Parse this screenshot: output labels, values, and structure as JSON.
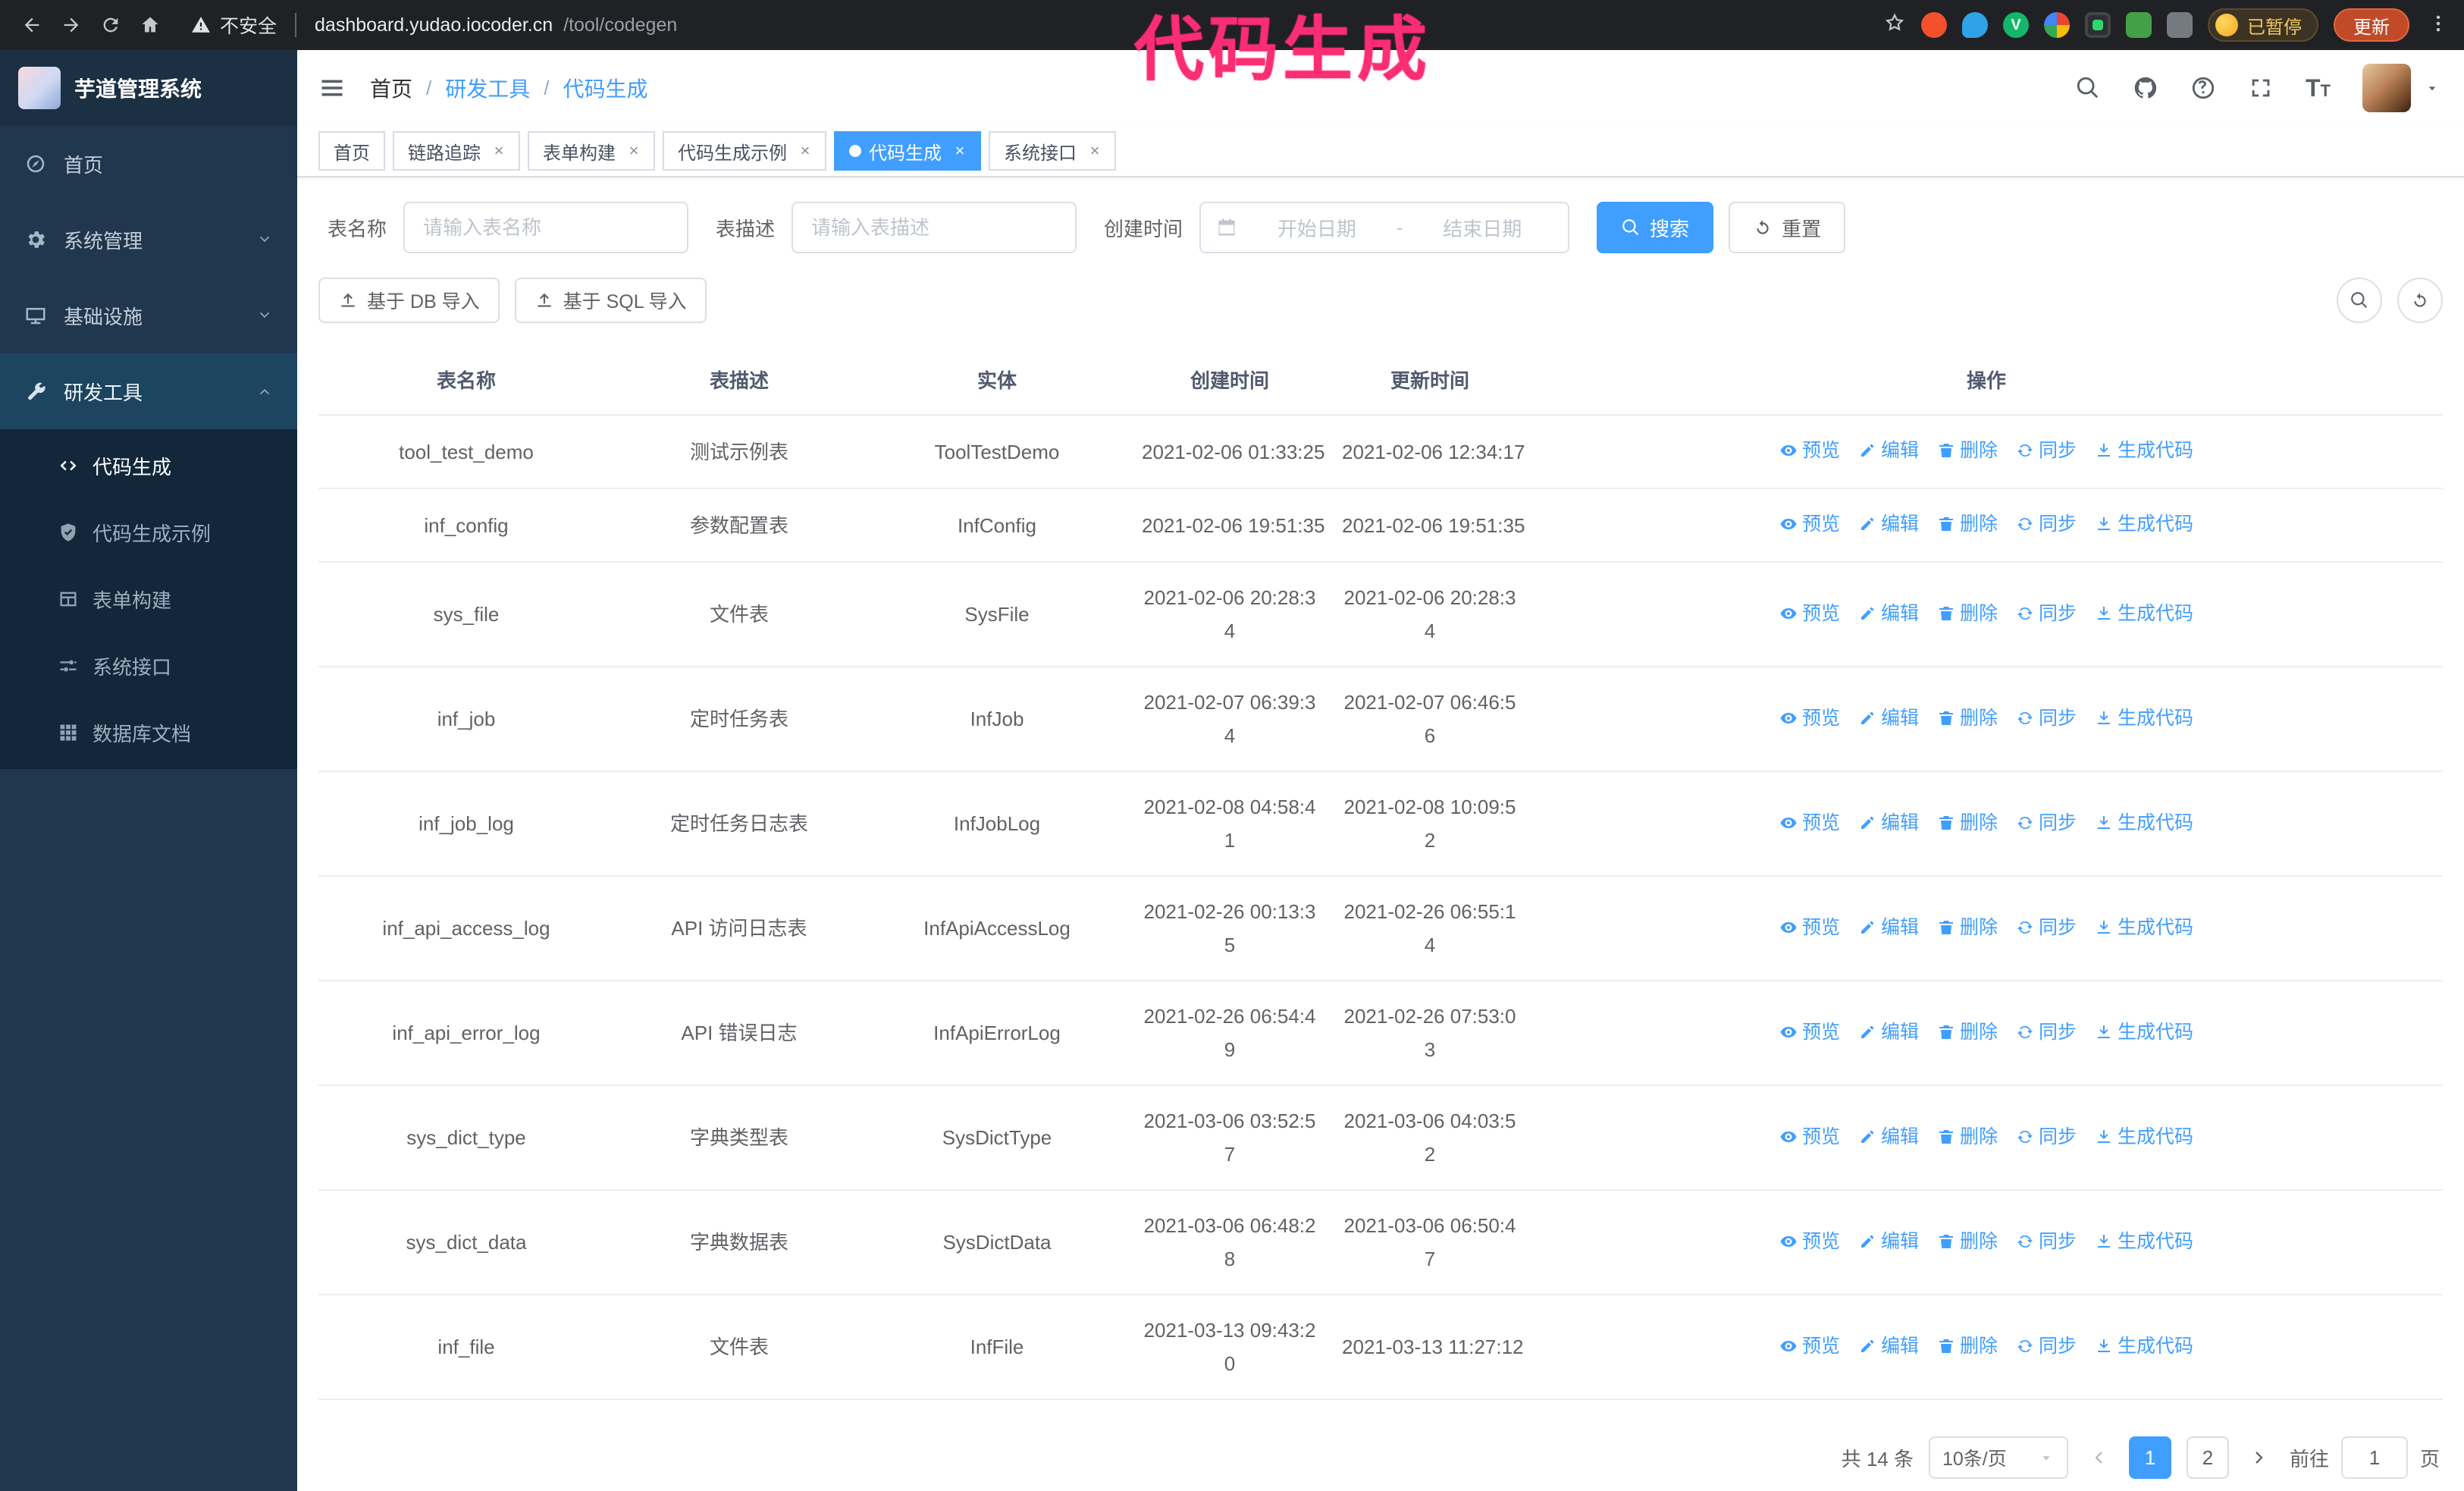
{
  "annotation": {
    "text": "代码生成",
    "color": "#fb2d74"
  },
  "colors": {
    "primary": "#409eff",
    "sidebar_bg": "#20374d",
    "submenu_bg": "#13273a",
    "tag_active": "#409eff",
    "annotation": "#fb2d74",
    "update_button_bg": "#c14a28"
  },
  "browser": {
    "security_warning": "不安全",
    "url_host": "dashboard.yudao.iocoder.cn",
    "url_path": "/tool/codegen",
    "profile_chip": "已暂停",
    "update_button": "更新"
  },
  "sidebar": {
    "logo_title": "芋道管理系统",
    "items": [
      {
        "label": "首页",
        "icon": "dashboard-icon"
      },
      {
        "label": "系统管理",
        "icon": "gear-icon"
      },
      {
        "label": "基础设施",
        "icon": "monitor-icon"
      },
      {
        "label": "研发工具",
        "icon": "wrench-icon"
      }
    ],
    "subitems": [
      {
        "label": "代码生成",
        "icon": "code-icon",
        "active": true
      },
      {
        "label": "代码生成示例",
        "icon": "shield-check-icon",
        "active": false
      },
      {
        "label": "表单构建",
        "icon": "form-icon",
        "active": false
      },
      {
        "label": "系统接口",
        "icon": "sliders-icon",
        "active": false
      },
      {
        "label": "数据库文档",
        "icon": "grid-icon",
        "active": false
      }
    ]
  },
  "header": {
    "breadcrumb": [
      "首页",
      "研发工具",
      "代码生成"
    ],
    "navbar_icons": [
      "search-icon",
      "github-icon",
      "question-icon",
      "fullscreen-icon",
      "font-size-icon",
      "avatar",
      "caret-down-icon"
    ]
  },
  "tabs": [
    {
      "label": "首页",
      "closable": false,
      "active": false
    },
    {
      "label": "链路追踪",
      "closable": true,
      "active": false
    },
    {
      "label": "表单构建",
      "closable": true,
      "active": false
    },
    {
      "label": "代码生成示例",
      "closable": true,
      "active": false
    },
    {
      "label": "代码生成",
      "closable": true,
      "active": true
    },
    {
      "label": "系统接口",
      "closable": true,
      "active": false
    }
  ],
  "filters": {
    "table_name_label": "表名称",
    "table_name_placeholder": "请输入表名称",
    "table_desc_label": "表描述",
    "table_desc_placeholder": "请输入表描述",
    "create_time_label": "创建时间",
    "date_start_placeholder": "开始日期",
    "date_separator": "-",
    "date_end_placeholder": "结束日期",
    "search_button": "搜索",
    "reset_button": "重置"
  },
  "toolbar": {
    "import_db": "基于 DB 导入",
    "import_sql": "基于 SQL 导入",
    "right_icons": [
      "search-icon",
      "refresh-icon"
    ]
  },
  "table": {
    "columns": [
      "表名称",
      "表描述",
      "实体",
      "创建时间",
      "更新时间",
      "操作"
    ],
    "actions": [
      "预览",
      "编辑",
      "删除",
      "同步",
      "生成代码"
    ],
    "action_icons": [
      "eye-icon",
      "edit-icon",
      "trash-icon",
      "sync-icon",
      "download-icon"
    ],
    "rows": [
      {
        "name": "tool_test_demo",
        "desc": "测试示例表",
        "entity": "ToolTestDemo",
        "created": "2021-02-06 01:33:25",
        "updated": "2021-02-06 12:34:17"
      },
      {
        "name": "inf_config",
        "desc": "参数配置表",
        "entity": "InfConfig",
        "created": "2021-02-06 19:51:35",
        "updated": "2021-02-06 19:51:35"
      },
      {
        "name": "sys_file",
        "desc": "文件表",
        "entity": "SysFile",
        "created": "2021-02-06 20:28:34",
        "updated": "2021-02-06 20:28:34"
      },
      {
        "name": "inf_job",
        "desc": "定时任务表",
        "entity": "InfJob",
        "created": "2021-02-07 06:39:34",
        "updated": "2021-02-07 06:46:56"
      },
      {
        "name": "inf_job_log",
        "desc": "定时任务日志表",
        "entity": "InfJobLog",
        "created": "2021-02-08 04:58:41",
        "updated": "2021-02-08 10:09:52"
      },
      {
        "name": "inf_api_access_log",
        "desc": "API 访问日志表",
        "entity": "InfApiAccessLog",
        "created": "2021-02-26 00:13:35",
        "updated": "2021-02-26 06:55:14"
      },
      {
        "name": "inf_api_error_log",
        "desc": "API 错误日志",
        "entity": "InfApiErrorLog",
        "created": "2021-02-26 06:54:49",
        "updated": "2021-02-26 07:53:03"
      },
      {
        "name": "sys_dict_type",
        "desc": "字典类型表",
        "entity": "SysDictType",
        "created": "2021-03-06 03:52:57",
        "updated": "2021-03-06 04:03:52"
      },
      {
        "name": "sys_dict_data",
        "desc": "字典数据表",
        "entity": "SysDictData",
        "created": "2021-03-06 06:48:28",
        "updated": "2021-03-06 06:50:47"
      },
      {
        "name": "inf_file",
        "desc": "文件表",
        "entity": "InfFile",
        "created": "2021-03-13 09:43:20",
        "updated": "2021-03-13 11:27:12"
      }
    ]
  },
  "pagination": {
    "total": "共 14 条",
    "page_size": "10条/页",
    "pages": [
      "1",
      "2"
    ],
    "active_page": "1",
    "goto_prefix": "前往",
    "goto_value": "1",
    "goto_suffix": "页"
  }
}
